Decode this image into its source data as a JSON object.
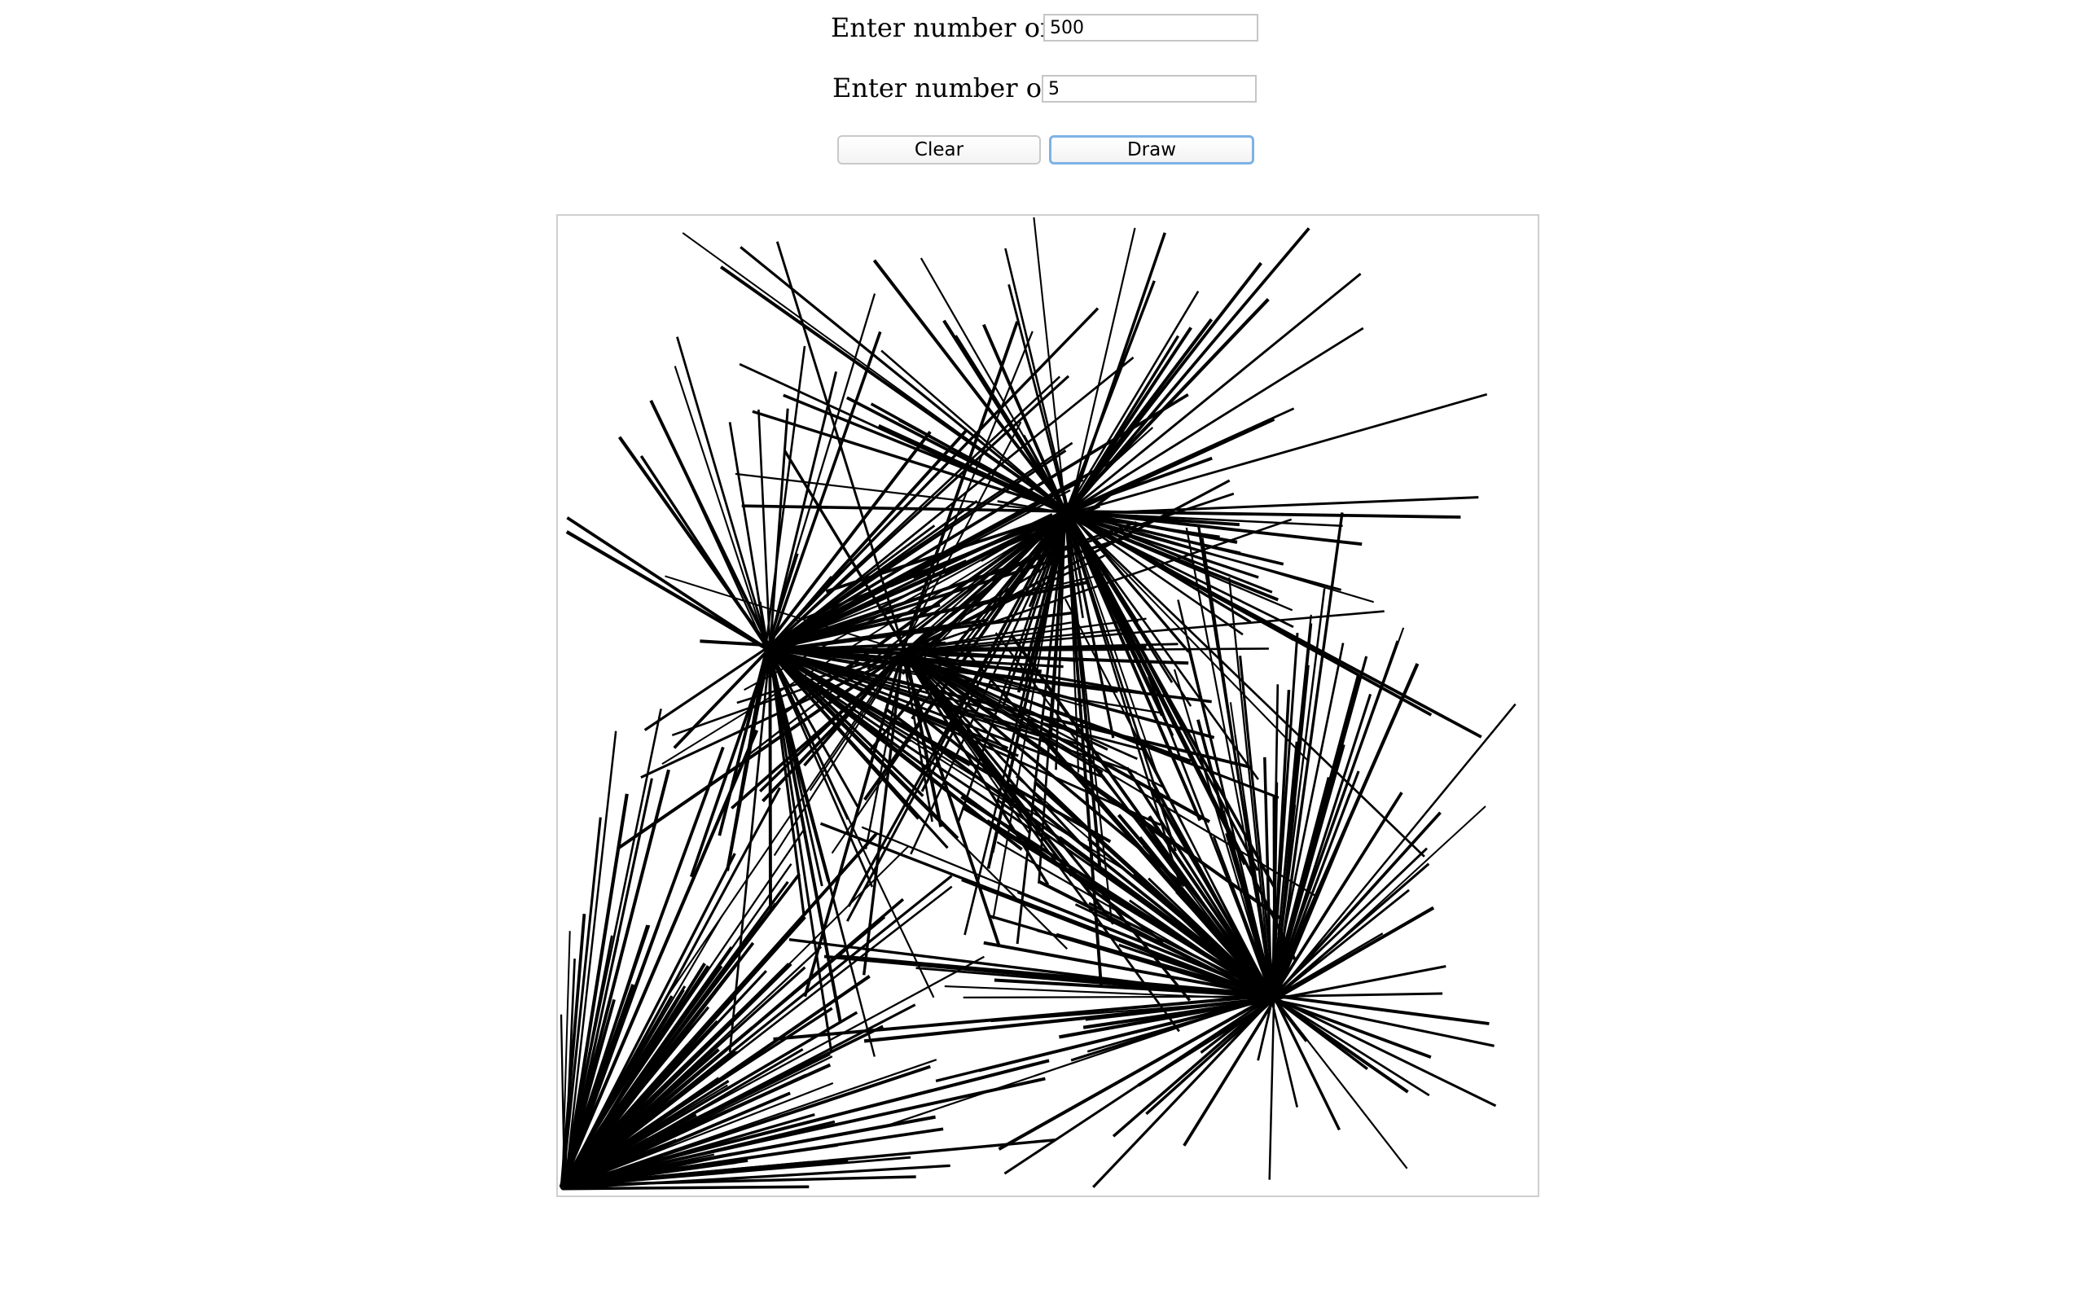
{
  "form": {
    "x_label": "Enter number of X:",
    "x_value": "500",
    "y_label": "Enter number of Y:",
    "y_value": "5",
    "clear_label": "Clear",
    "draw_label": "Draw"
  },
  "colors": {
    "stroke": "#000000",
    "focus_ring": "#7eb2e6"
  }
}
